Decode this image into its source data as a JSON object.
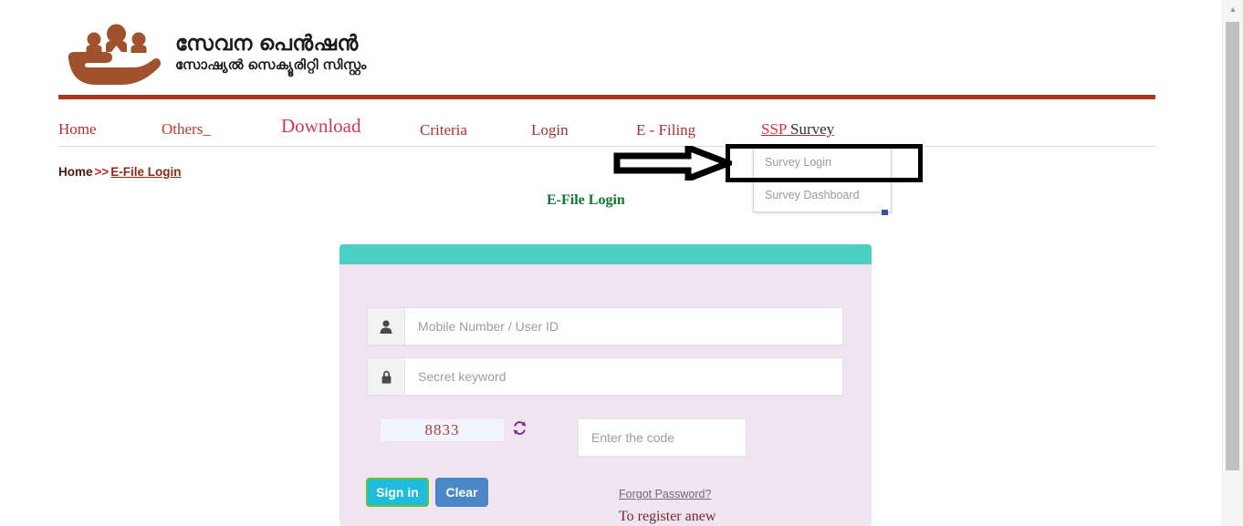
{
  "header": {
    "logo_icon": "hand-holding-people-icon",
    "title": "സേവന പെൻഷൻ",
    "subtitle": "സോഷ്യൽ സെക്യൂരിറ്റി സിസ്റ്റം",
    "brand_color": "#a8371f",
    "logo_color": "#a0522d"
  },
  "nav": {
    "items": [
      {
        "label": "Home"
      },
      {
        "label": "Others",
        "caret": "_"
      },
      {
        "label": "Download"
      },
      {
        "label": "Criteria"
      },
      {
        "label": "Login"
      },
      {
        "label": "E - Filing"
      }
    ],
    "ssp_survey": {
      "part1": "SSP",
      "part2": "Survey"
    }
  },
  "dropdown": {
    "items": [
      {
        "label": "Survey Login"
      },
      {
        "label": "Survey Dashboard"
      }
    ]
  },
  "breadcrumb": {
    "home": "Home",
    "separator": ">>",
    "current": "E-File Login"
  },
  "page": {
    "heading": "E-File Login"
  },
  "login_form": {
    "header_color": "#4dd0c4",
    "card_color": "#efe4ef",
    "username": {
      "icon": "user-icon",
      "placeholder": "Mobile Number / User ID",
      "value": ""
    },
    "password": {
      "icon": "lock-icon",
      "placeholder": "Secret keyword",
      "value": ""
    },
    "captcha": {
      "code": "8833",
      "refresh_icon": "refresh-icon",
      "input_placeholder": "Enter the code",
      "input_value": ""
    },
    "buttons": {
      "signin": "Sign in",
      "clear": "Clear",
      "signin_color": "#20bcdd",
      "clear_color": "#4a86c8"
    },
    "links": {
      "forgot": "Forgot Password?",
      "register": "To register anew"
    }
  },
  "scrollbar": {
    "up_arrow": "▲"
  }
}
